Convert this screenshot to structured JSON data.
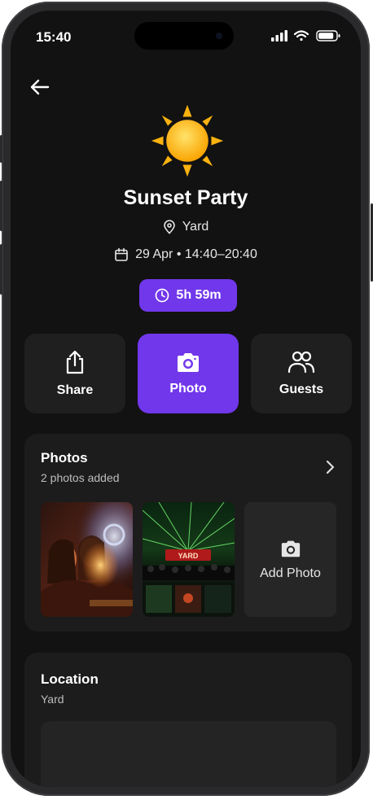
{
  "status": {
    "time": "15:40"
  },
  "event": {
    "title": "Sunset Party",
    "location": "Yard",
    "date_time": "29 Apr • 14:40–20:40",
    "duration": "5h 59m",
    "icon": "sun-icon"
  },
  "actions": [
    {
      "label": "Share",
      "icon": "share-icon"
    },
    {
      "label": "Photo",
      "icon": "camera-icon",
      "active": true
    },
    {
      "label": "Guests",
      "icon": "users-icon"
    }
  ],
  "photos": {
    "title": "Photos",
    "subtitle": "2 photos added",
    "add_label": "Add Photo",
    "thumb_overlay_text": "YARD"
  },
  "location": {
    "title": "Location",
    "value": "Yard"
  },
  "colors": {
    "accent": "#7137EA",
    "background": "#121212",
    "card": "#1C1C1C",
    "sun": "#FDB515"
  }
}
